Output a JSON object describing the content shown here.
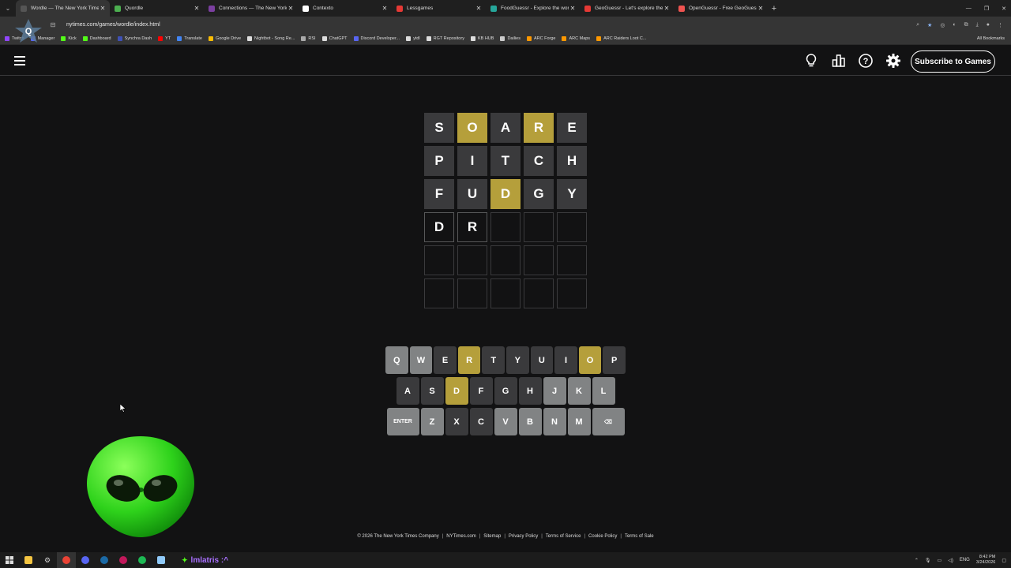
{
  "browser": {
    "tabs": [
      {
        "title": "Wordle — The New York Times",
        "color": "#555555",
        "active": true
      },
      {
        "title": "Quordle",
        "color": "#4caf50"
      },
      {
        "title": "Connections — The New York T",
        "color": "#7b3fa0"
      },
      {
        "title": "Contexto",
        "color": "#ffffff"
      },
      {
        "title": "Lessgames",
        "color": "#e53935"
      },
      {
        "title": "FoodGuessr - Explore the worl",
        "color": "#26a69a"
      },
      {
        "title": "GeoGuessr - Let's explore the w",
        "color": "#e53935"
      },
      {
        "title": "OpenGuessr - Free GeoGuessr",
        "color": "#ef5350"
      }
    ],
    "url": "nytimes.com/games/wordle/index.html",
    "bookmarks": [
      {
        "label": "Twitch",
        "color": "#9146ff"
      },
      {
        "label": "Manager",
        "color": "#5865f2"
      },
      {
        "label": "Kick",
        "color": "#53fc18"
      },
      {
        "label": "Dashboard",
        "color": "#53fc18"
      },
      {
        "label": "Synchra Dash",
        "color": "#3f51b5"
      },
      {
        "label": "YT",
        "color": "#ff0000"
      },
      {
        "label": "Translate",
        "color": "#4285f4"
      },
      {
        "label": "Google Drive",
        "color": "#fbbc04"
      },
      {
        "label": "Nightbot - Song Re...",
        "color": "#dddddd"
      },
      {
        "label": "RSI",
        "color": "#aaaaaa"
      },
      {
        "label": "ChatGPT",
        "color": "#dddddd"
      },
      {
        "label": "Discord Developer...",
        "color": "#5865f2"
      },
      {
        "label": "ytdl",
        "color": "#dddddd"
      },
      {
        "label": "RGT Repository",
        "color": "#dddddd"
      },
      {
        "label": "KB HUB",
        "color": "#dddddd"
      },
      {
        "label": "Dailies",
        "color": "#cccccc"
      },
      {
        "label": "ARC Forge",
        "color": "#ff9800"
      },
      {
        "label": "ARC Maps",
        "color": "#ff9800"
      },
      {
        "label": "ARC Raiders Loot C...",
        "color": "#ff9800"
      }
    ],
    "all_bookmarks": "All Bookmarks"
  },
  "header": {
    "subscribe_label": "Subscribe to Games"
  },
  "board": [
    [
      {
        "l": "S",
        "s": "absent"
      },
      {
        "l": "O",
        "s": "present"
      },
      {
        "l": "A",
        "s": "absent"
      },
      {
        "l": "R",
        "s": "present"
      },
      {
        "l": "E",
        "s": "absent"
      }
    ],
    [
      {
        "l": "P",
        "s": "absent"
      },
      {
        "l": "I",
        "s": "absent"
      },
      {
        "l": "T",
        "s": "absent"
      },
      {
        "l": "C",
        "s": "absent"
      },
      {
        "l": "H",
        "s": "absent"
      }
    ],
    [
      {
        "l": "F",
        "s": "absent"
      },
      {
        "l": "U",
        "s": "absent"
      },
      {
        "l": "D",
        "s": "present"
      },
      {
        "l": "G",
        "s": "absent"
      },
      {
        "l": "Y",
        "s": "absent"
      }
    ],
    [
      {
        "l": "D",
        "s": "tbd"
      },
      {
        "l": "R",
        "s": "tbd"
      },
      {
        "l": "",
        "s": "empty"
      },
      {
        "l": "",
        "s": "empty"
      },
      {
        "l": "",
        "s": "empty"
      }
    ],
    [
      {
        "l": "",
        "s": "empty"
      },
      {
        "l": "",
        "s": "empty"
      },
      {
        "l": "",
        "s": "empty"
      },
      {
        "l": "",
        "s": "empty"
      },
      {
        "l": "",
        "s": "empty"
      }
    ],
    [
      {
        "l": "",
        "s": "empty"
      },
      {
        "l": "",
        "s": "empty"
      },
      {
        "l": "",
        "s": "empty"
      },
      {
        "l": "",
        "s": "empty"
      },
      {
        "l": "",
        "s": "empty"
      }
    ]
  ],
  "keyboard": [
    [
      {
        "k": "Q",
        "s": "unused"
      },
      {
        "k": "W",
        "s": "unused"
      },
      {
        "k": "E",
        "s": "absent"
      },
      {
        "k": "R",
        "s": "present"
      },
      {
        "k": "T",
        "s": "absent"
      },
      {
        "k": "Y",
        "s": "absent"
      },
      {
        "k": "U",
        "s": "absent"
      },
      {
        "k": "I",
        "s": "absent"
      },
      {
        "k": "O",
        "s": "present"
      },
      {
        "k": "P",
        "s": "absent"
      }
    ],
    [
      {
        "k": "A",
        "s": "absent"
      },
      {
        "k": "S",
        "s": "absent"
      },
      {
        "k": "D",
        "s": "present"
      },
      {
        "k": "F",
        "s": "absent"
      },
      {
        "k": "G",
        "s": "absent"
      },
      {
        "k": "H",
        "s": "absent"
      },
      {
        "k": "J",
        "s": "unused"
      },
      {
        "k": "K",
        "s": "unused"
      },
      {
        "k": "L",
        "s": "unused"
      }
    ],
    [
      {
        "k": "ENTER",
        "s": "unused",
        "wide": true
      },
      {
        "k": "Z",
        "s": "unused"
      },
      {
        "k": "X",
        "s": "absent"
      },
      {
        "k": "C",
        "s": "absent"
      },
      {
        "k": "V",
        "s": "unused"
      },
      {
        "k": "B",
        "s": "unused"
      },
      {
        "k": "N",
        "s": "unused"
      },
      {
        "k": "M",
        "s": "unused"
      },
      {
        "k": "⌫",
        "s": "unused",
        "wide": true
      }
    ]
  ],
  "footer": [
    "© 2026 The New York Times Company",
    "NYTimes.com",
    "Sitemap",
    "Privacy Policy",
    "Terms of Service",
    "Cookie Policy",
    "Terms of Sale"
  ],
  "taskbar": {
    "now_playing": "lmlatris :^",
    "lang": "ENG",
    "time": "8:42 PM",
    "date": "3/24/2026"
  },
  "colors": {
    "background": "#121213",
    "absent": "#3a3a3c",
    "present": "#b59f3b",
    "unused": "#818384"
  }
}
